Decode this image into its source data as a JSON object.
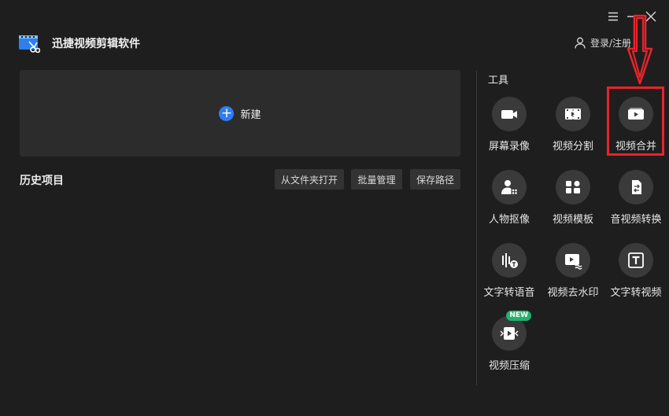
{
  "window": {
    "menu_icon": "hamburger-icon",
    "minimize_icon": "minimize-icon",
    "close_icon": "close-icon"
  },
  "header": {
    "app_title": "迅捷视频剪辑软件",
    "login_label": "登录/注册"
  },
  "main": {
    "new_label": "新建",
    "history_title": "历史项目",
    "buttons": {
      "open_folder": "从文件夹打开",
      "batch_manage": "批量管理",
      "save_path": "保存路径"
    }
  },
  "tools": {
    "title": "工具",
    "items": [
      {
        "label": "屏幕录像",
        "icon": "camera-icon"
      },
      {
        "label": "视频分割",
        "icon": "film-split-icon"
      },
      {
        "label": "视频合并",
        "icon": "video-merge-icon"
      },
      {
        "label": "人物抠像",
        "icon": "portrait-cutout-icon"
      },
      {
        "label": "视频模板",
        "icon": "template-icon"
      },
      {
        "label": "音视频转换",
        "icon": "convert-icon"
      },
      {
        "label": "文字转语音",
        "icon": "text-to-speech-icon"
      },
      {
        "label": "视频去水印",
        "icon": "watermark-remove-icon"
      },
      {
        "label": "文字转视频",
        "icon": "text-to-video-icon"
      },
      {
        "label": "视频压缩",
        "icon": "video-compress-icon",
        "badge": "NEW"
      }
    ]
  },
  "colors": {
    "background": "#1e1e1e",
    "accent": "#2f7df6",
    "highlight": "#e8232b",
    "badge": "#1fb36c"
  }
}
